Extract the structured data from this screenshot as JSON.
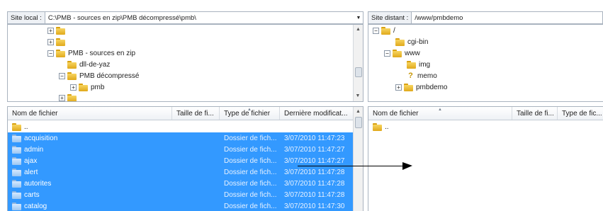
{
  "local": {
    "address_label": "Site local :",
    "address_value": "C:\\PMB - sources en zip\\PMB  décompressé\\pmb\\",
    "tree": [
      {
        "label": "",
        "expander": "+",
        "level": 0
      },
      {
        "label": "",
        "expander": "+",
        "level": 0
      },
      {
        "label": "PMB - sources en zip",
        "expander": "−",
        "level": 0
      },
      {
        "label": "dll-de-yaz",
        "expander": "",
        "level": 1
      },
      {
        "label": "PMB  décompressé",
        "expander": "−",
        "level": 1
      },
      {
        "label": "pmb",
        "expander": "+",
        "level": 2
      },
      {
        "label": "",
        "expander": "+",
        "level": 0
      }
    ],
    "columns": [
      "Nom de fichier",
      "Taille de fi...",
      "Type de fichier",
      "Dernière modificat..."
    ],
    "parent_dir": "..",
    "files": [
      {
        "name": "acquisition",
        "size": "",
        "type": "Dossier de fich...",
        "modified": "3/07/2010 11:47:23"
      },
      {
        "name": "admin",
        "size": "",
        "type": "Dossier de fich...",
        "modified": "3/07/2010 11:47:27"
      },
      {
        "name": "ajax",
        "size": "",
        "type": "Dossier de fich...",
        "modified": "3/07/2010 11:47:27"
      },
      {
        "name": "alert",
        "size": "",
        "type": "Dossier de fich...",
        "modified": "3/07/2010 11:47:28"
      },
      {
        "name": "autorites",
        "size": "",
        "type": "Dossier de fich...",
        "modified": "3/07/2010 11:47:28"
      },
      {
        "name": "carts",
        "size": "",
        "type": "Dossier de fich...",
        "modified": "3/07/2010 11:47:28"
      },
      {
        "name": "catalog",
        "size": "",
        "type": "Dossier de fich...",
        "modified": "3/07/2010 11:47:30"
      }
    ]
  },
  "remote": {
    "address_label": "Site distant :",
    "address_value": "/www/pmbdemo",
    "tree": [
      {
        "label": "/",
        "expander": "−",
        "level": 0,
        "icon": "folder"
      },
      {
        "label": "cgi-bin",
        "expander": "",
        "level": 1,
        "icon": "folder"
      },
      {
        "label": "www",
        "expander": "−",
        "level": 1,
        "icon": "folder"
      },
      {
        "label": "img",
        "expander": "",
        "level": 2,
        "icon": "folder"
      },
      {
        "label": "memo",
        "expander": "",
        "level": 2,
        "icon": "unknown"
      },
      {
        "label": "pmbdemo",
        "expander": "+",
        "level": 2,
        "icon": "folder"
      }
    ],
    "columns": [
      "Nom de fichier",
      "Taille de fi...",
      "Type de fic..."
    ],
    "parent_dir": ".."
  },
  "colors": {
    "selection": "#3399ff",
    "folder": "#f2c94c"
  }
}
